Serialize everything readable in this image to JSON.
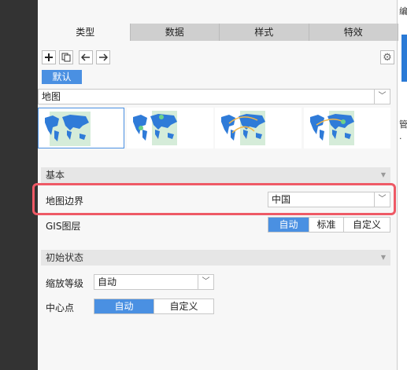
{
  "tabs": [
    "类型",
    "数据",
    "样式",
    "特效"
  ],
  "toolbar": {
    "add_icon": "plus-icon",
    "copy_icon": "copy-icon",
    "left_icon": "arrow-left-icon",
    "right_icon": "arrow-right-icon",
    "settings_icon": "gear-icon"
  },
  "default_tag": "默认",
  "chart_type": {
    "value": "地图"
  },
  "thumbnails": [
    "world-map-area",
    "world-map-point",
    "world-map-flow",
    "world-map-heat"
  ],
  "sections": {
    "basic": "基本",
    "initial": "初始状态"
  },
  "map_boundary": {
    "label": "地图边界",
    "value": "中国"
  },
  "gis_layer": {
    "label": "GIS图层",
    "options": [
      "自动",
      "标准",
      "自定义"
    ],
    "active": 0
  },
  "zoom_level": {
    "label": "缩放等级",
    "value": "自动"
  },
  "center_point": {
    "label": "中心点",
    "options": [
      "自动",
      "自定义"
    ],
    "active": 0
  },
  "right_edge_text": [
    "编",
    "管",
    "·"
  ],
  "colors": {
    "accent": "#4a90e2",
    "highlight": "#ee5a66",
    "map_land": "#2f7bd8",
    "map_bg": "#d5ecd9"
  }
}
